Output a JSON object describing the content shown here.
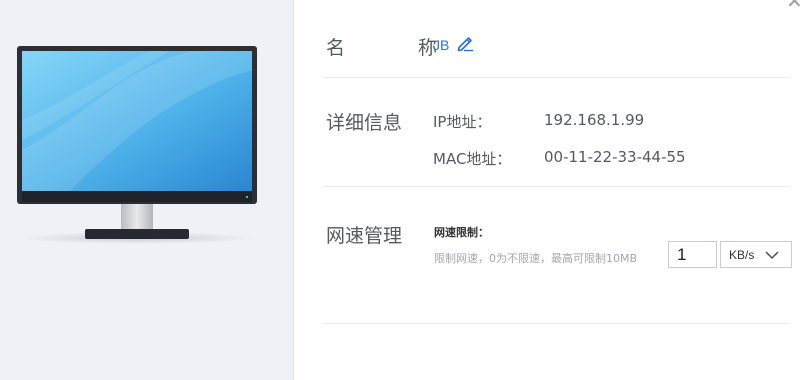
{
  "device": {
    "name_label": "名　称",
    "name": "JB",
    "edit_icon": "pencil-edit-icon"
  },
  "details": {
    "section_label": "详细信息",
    "ip_label": "IP地址：",
    "ip_value": "192.168.1.99",
    "mac_label": "MAC地址：",
    "mac_value": "00-11-22-33-44-55"
  },
  "speed": {
    "section_label": "网速管理",
    "limit_title": "网速限制：",
    "hint": "限制网速，0为不限速，最高可限制10MB",
    "value": "1",
    "unit": "KB/s"
  },
  "icons": {
    "close": "close-icon",
    "monitor": "monitor-icon",
    "chevron": "chevron-down-icon"
  },
  "colors": {
    "accent": "#2e6fd1",
    "panel_bg": "#eef1f5",
    "screen_light": "#7fd0f5",
    "screen_dark": "#2c8ed6"
  }
}
